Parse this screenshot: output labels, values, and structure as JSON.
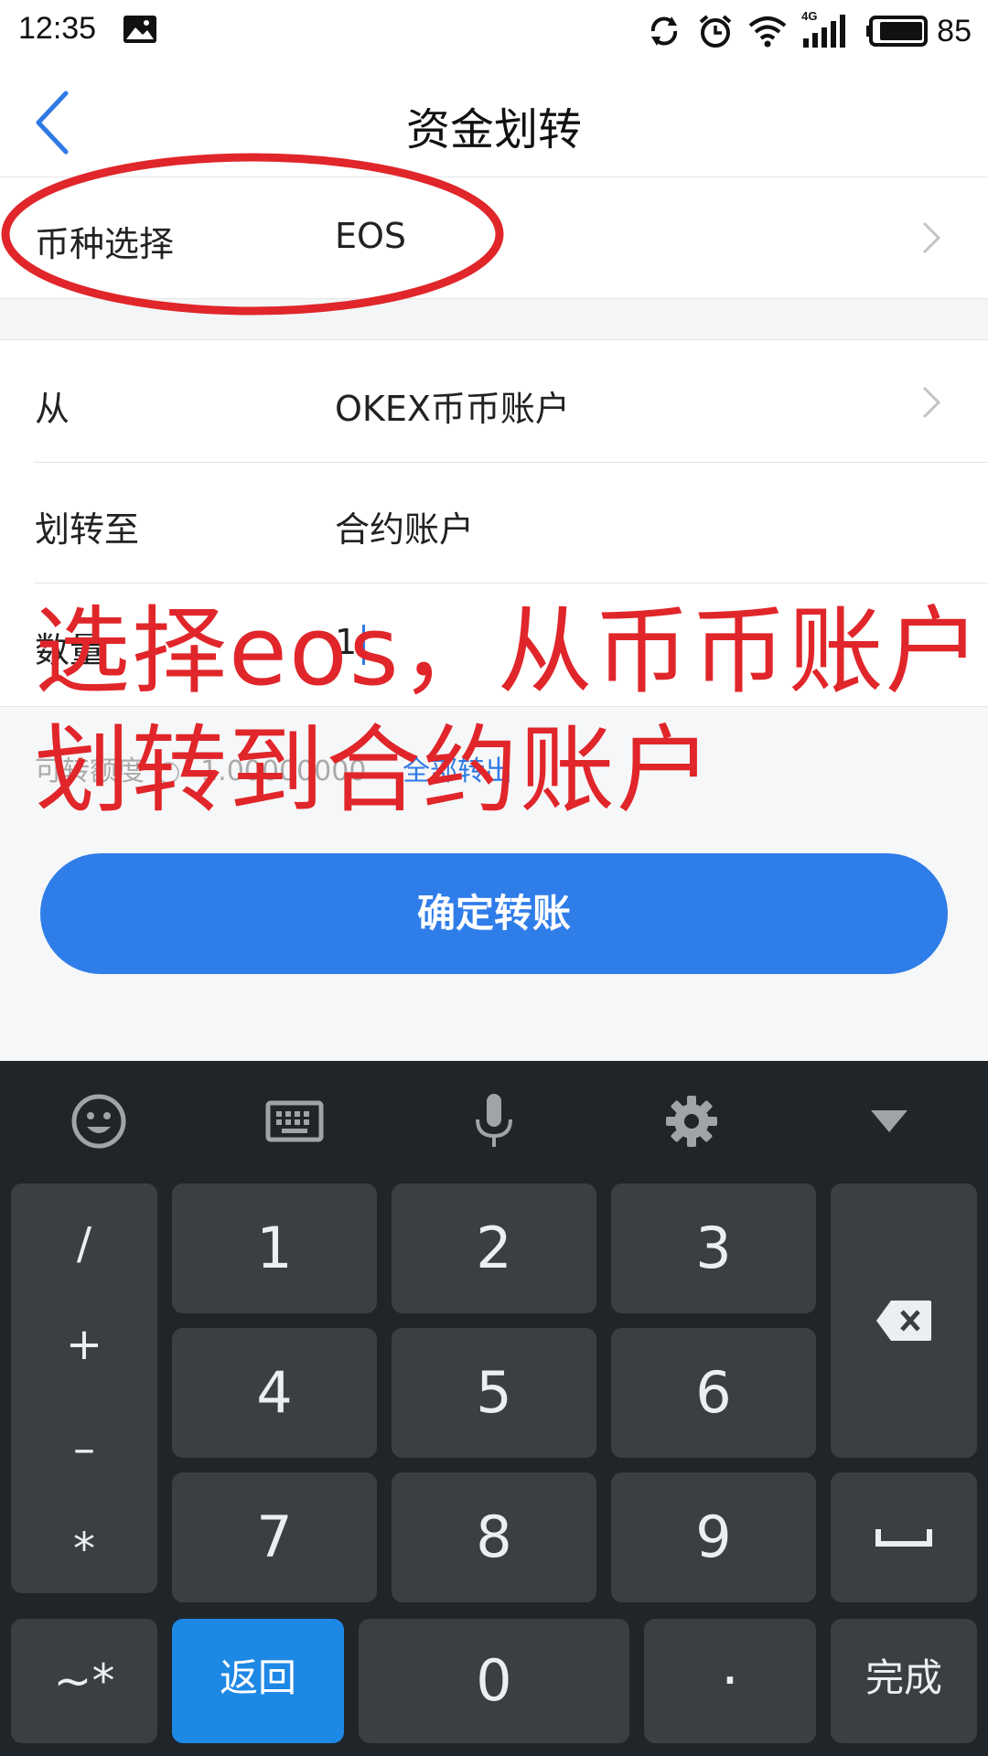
{
  "status_bar": {
    "time": "12:35",
    "battery": "85",
    "network": "4G",
    "icons": [
      "photo-icon",
      "sync-icon",
      "alarm-icon",
      "wifi-icon",
      "signal-icon",
      "battery-icon"
    ]
  },
  "header": {
    "title": "资金划转",
    "back_icon": "back-arrow-icon"
  },
  "form": {
    "currency": {
      "label": "币种选择",
      "value": "EOS"
    },
    "from": {
      "label": "从",
      "value": "OKEX币币账户"
    },
    "to": {
      "label": "划转至",
      "value": "合约账户"
    },
    "amount": {
      "label": "数量",
      "value": "1"
    },
    "available": {
      "label": "可转额度",
      "value": "1.00000000",
      "all_label": "全部转出"
    }
  },
  "confirm_button": {
    "label": "确定转账"
  },
  "annotation": {
    "line1": "选择eos，从币币账户",
    "line2": "划转到合约账户",
    "color": "#e0262a"
  },
  "keyboard": {
    "toolbar": [
      "emoji-icon",
      "keyboard-icon",
      "mic-icon",
      "settings-icon",
      "collapse-icon"
    ],
    "symbols": [
      "/",
      "+",
      "–",
      "*"
    ],
    "digits": [
      "1",
      "2",
      "3",
      "4",
      "5",
      "6",
      "7",
      "8",
      "9"
    ],
    "tilde_key": "~*",
    "back_key": "返回",
    "zero_key": "0",
    "dot_key": "·",
    "done_key": "完成",
    "accent": "#1e88e5"
  }
}
